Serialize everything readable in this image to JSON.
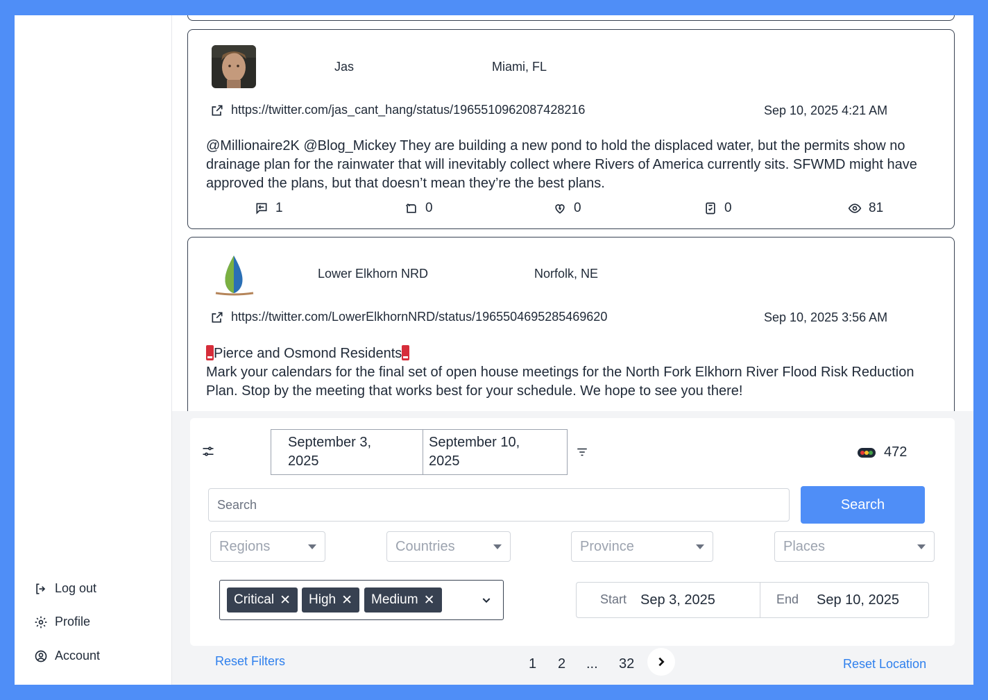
{
  "sidebar": {
    "items": [
      {
        "label": "Log out",
        "icon": "logout-icon"
      },
      {
        "label": "Profile",
        "icon": "gear-icon"
      },
      {
        "label": "Account",
        "icon": "user-circle-icon"
      }
    ]
  },
  "posts": [
    {
      "username": "Jas",
      "location": "Miami, FL",
      "url": "https://twitter.com/jas_cant_hang/status/1965510962087428216",
      "timestamp": "Sep 10, 2025 4:21 AM",
      "text": "@Millionaire2K @Blog_Mickey They are building a new pond to hold the displaced water, but the permits show no drainage plan for the rainwater that will inevitably collect where Rivers of America currently sits. SFWMD might have approved the plans, but that doesn’t mean they’re the best plans.",
      "stats": {
        "replies": "1",
        "retweets": "0",
        "likes": "0",
        "bookmarks": "0",
        "views": "81"
      }
    },
    {
      "username": "Lower Elkhorn NRD",
      "location": "Norfolk, NE",
      "url": "https://twitter.com/LowerElkhornNRD/status/1965504695285469620",
      "timestamp": "Sep 10, 2025 3:56 AM",
      "headline": "Pierce and Osmond Residents",
      "text": "Mark your calendars for the final set of open house meetings for the North Fork Elkhorn River Flood Risk Reduction Plan. Stop by the meeting that works best for your schedule. We hope to see you there!"
    }
  ],
  "filters": {
    "date_from": "September 3, 2025",
    "date_to": "September 10, 2025",
    "result_count": "472",
    "search_placeholder": "Search",
    "search_button": "Search",
    "regions_placeholder": "Regions",
    "countries_placeholder": "Countries",
    "province_placeholder": "Province",
    "places_placeholder": "Places",
    "severity_tags": [
      "Critical",
      "High",
      "Medium"
    ],
    "start_label": "Start",
    "start_value": "Sep 3, 2025",
    "end_label": "End",
    "end_value": "Sep 10, 2025"
  },
  "footer": {
    "reset_filters": "Reset Filters",
    "reset_location": "Reset Location",
    "pages": [
      "1",
      "2",
      "...",
      "32"
    ]
  },
  "colors": {
    "accent": "#4f8ef7",
    "link": "#2f80ed",
    "tag_bg": "#374151"
  }
}
